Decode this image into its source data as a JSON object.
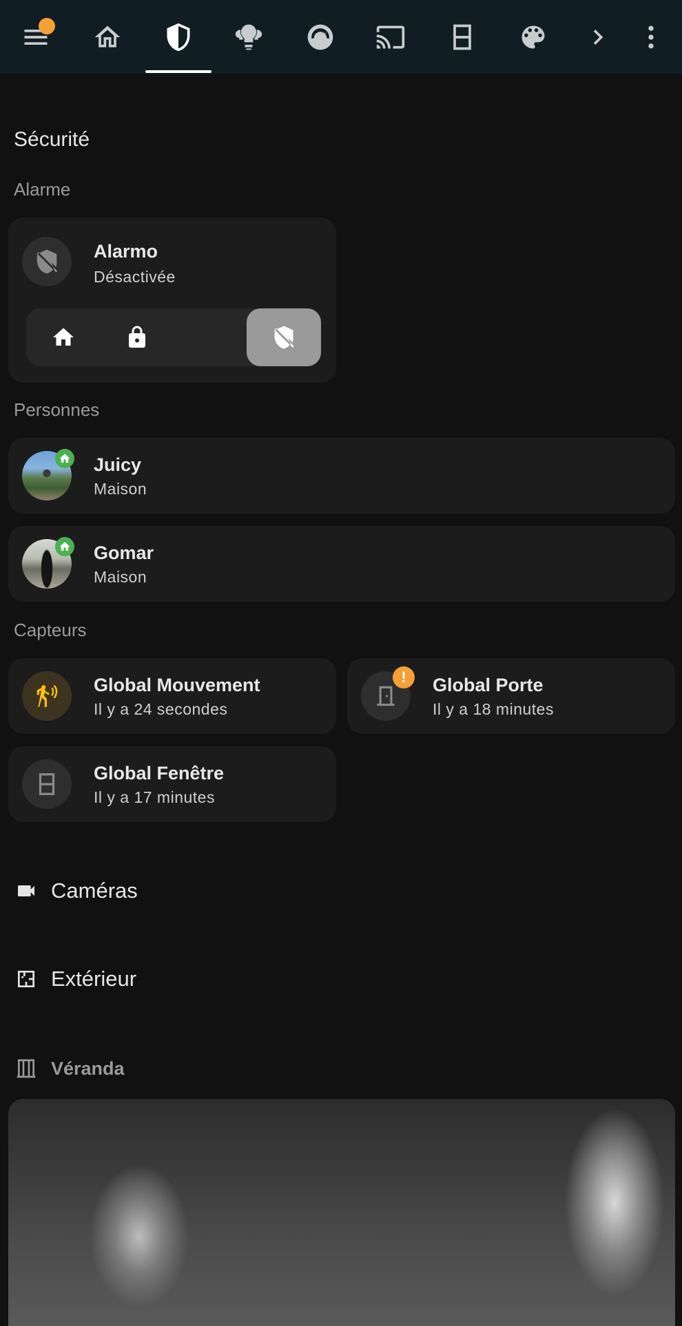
{
  "topbar": {
    "tabs": [
      {
        "icon": "home-outline-icon"
      },
      {
        "icon": "shield-half-icon",
        "active": true
      },
      {
        "icon": "lightbulb-group-icon"
      },
      {
        "icon": "gauge-icon"
      },
      {
        "icon": "cast-icon"
      },
      {
        "icon": "window-closed-icon"
      },
      {
        "icon": "palette-icon"
      }
    ],
    "menu_icon": "menu-icon",
    "more_icon": "dots-vertical-icon",
    "next_icon": "chevron-right-icon",
    "notification_color": "#f5a035"
  },
  "view": {
    "title": "Sécurité"
  },
  "sections": {
    "alarm": "Alarme",
    "people": "Personnes",
    "sensors": "Capteurs"
  },
  "alarm": {
    "name": "Alarmo",
    "state": "Désactivée",
    "modes": [
      {
        "icon": "home-icon"
      },
      {
        "icon": "lock-icon"
      },
      {
        "icon": "moon-icon"
      },
      {
        "icon": "shield-off-icon",
        "active": true
      }
    ]
  },
  "people": [
    {
      "name": "Juicy",
      "state": "Maison"
    },
    {
      "name": "Gomar",
      "state": "Maison"
    }
  ],
  "sensors": [
    {
      "name": "Global Mouvement",
      "state": "Il y a 24 secondes",
      "icon": "motion-sensor-icon",
      "color": "#ffc107"
    },
    {
      "name": "Global Porte",
      "state": "Il y a 18 minutes",
      "icon": "door-icon",
      "badge": "!"
    },
    {
      "name": "Global Fenêtre",
      "state": "Il y a 17 minutes",
      "icon": "window-icon"
    }
  ],
  "headings": {
    "cameras": "Caméras",
    "exterior": "Extérieur",
    "veranda": "Véranda"
  },
  "colors": {
    "background": "#111111",
    "card": "#1c1c1c",
    "topbar": "#101e24",
    "home_badge": "#4caf50",
    "warning": "#f5a035"
  }
}
